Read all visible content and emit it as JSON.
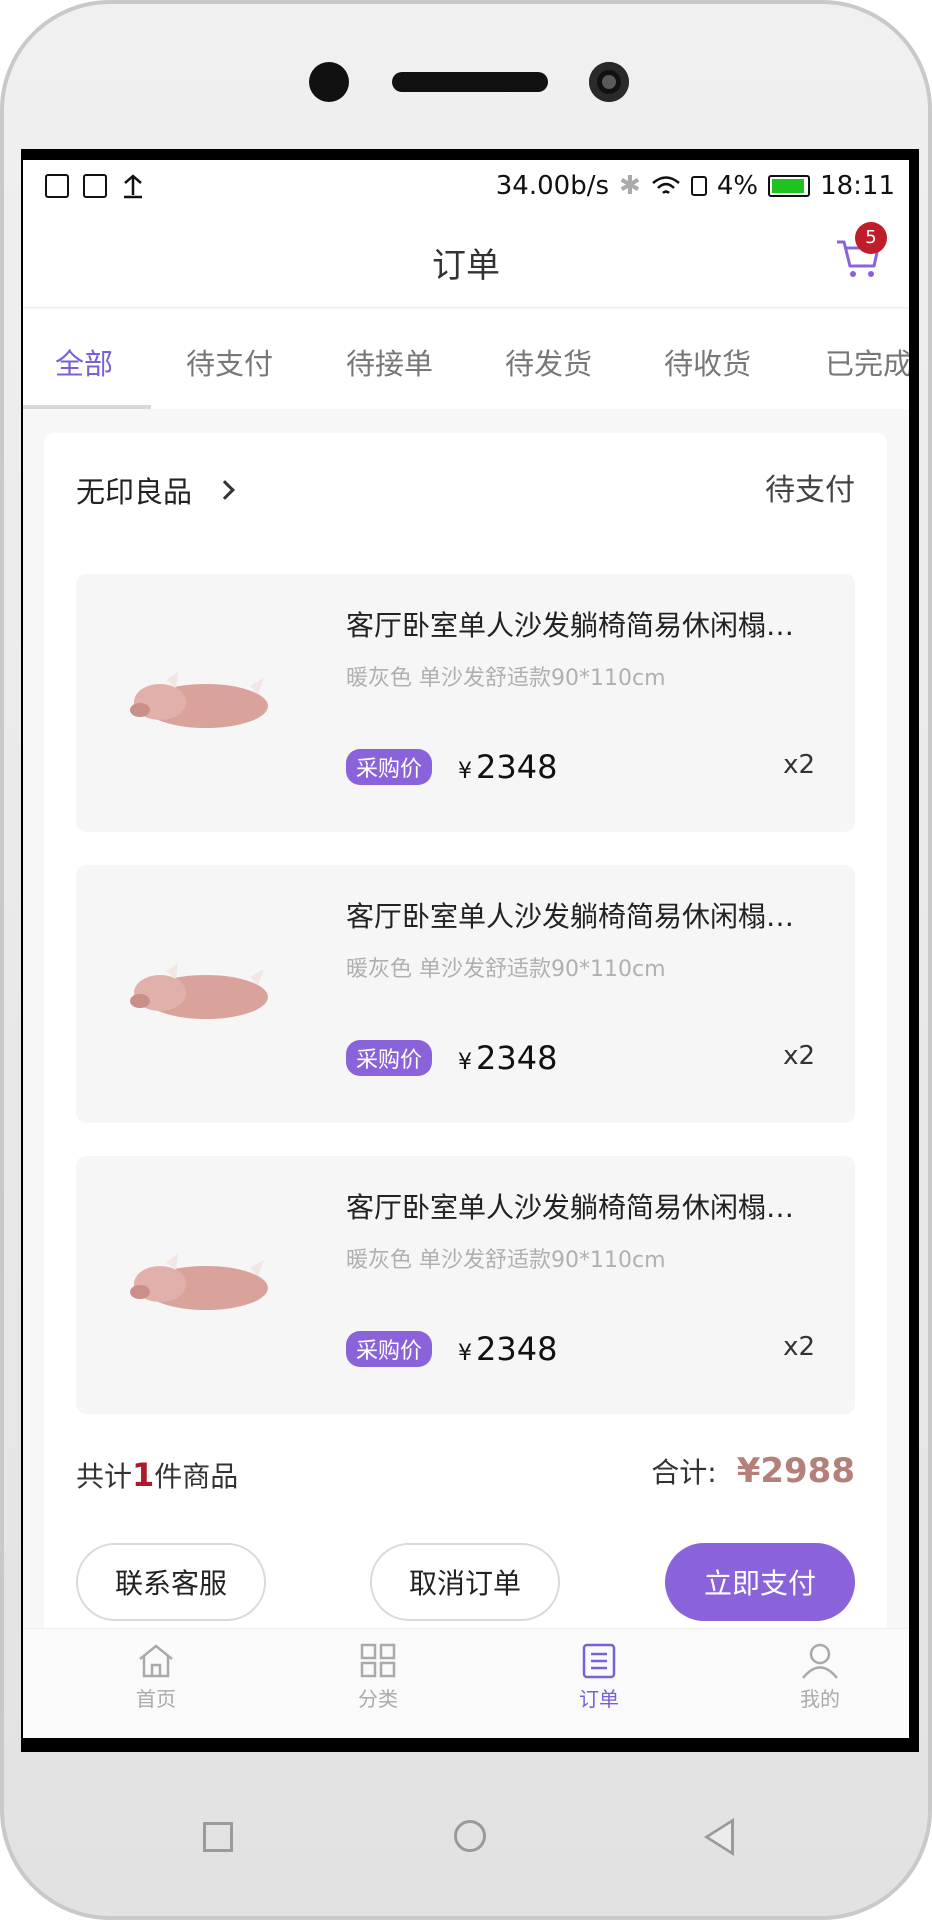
{
  "status_bar": {
    "speed": "34.00b/s",
    "battery": "4%",
    "time": "18:11"
  },
  "header": {
    "title": "订单",
    "cart_badge": "5"
  },
  "tabs": [
    "全部",
    "待支付",
    "待接单",
    "待发货",
    "待收货",
    "已完成"
  ],
  "order": {
    "shop_name": "无印良品",
    "status": "待支付",
    "items": [
      {
        "title": "客厅卧室单人沙发躺椅简易休闲榻…",
        "spec": "暖灰色 单沙发舒适款90*110cm",
        "badge": "采购价",
        "currency": "¥",
        "price": "2348",
        "qty": "x2"
      },
      {
        "title": "客厅卧室单人沙发躺椅简易休闲榻…",
        "spec": "暖灰色 单沙发舒适款90*110cm",
        "badge": "采购价",
        "currency": "¥",
        "price": "2348",
        "qty": "x2"
      },
      {
        "title": "客厅卧室单人沙发躺椅简易休闲榻…",
        "spec": "暖灰色 单沙发舒适款90*110cm",
        "badge": "采购价",
        "currency": "¥",
        "price": "2348",
        "qty": "x2"
      }
    ],
    "summary_prefix": "共计",
    "summary_count": "1",
    "summary_suffix": "件商品",
    "total_label": "合计:",
    "total_value": "¥2988",
    "buttons": {
      "contact": "联系客服",
      "cancel": "取消订单",
      "pay": "立即支付"
    }
  },
  "tabbar": [
    {
      "label": "首页",
      "icon": "home-icon"
    },
    {
      "label": "分类",
      "icon": "grid-icon"
    },
    {
      "label": "订单",
      "icon": "orders-icon"
    },
    {
      "label": "我的",
      "icon": "user-icon"
    }
  ],
  "colors": {
    "accent": "#8a63db",
    "badge_red": "#c01d2a",
    "total": "#b4807a"
  }
}
